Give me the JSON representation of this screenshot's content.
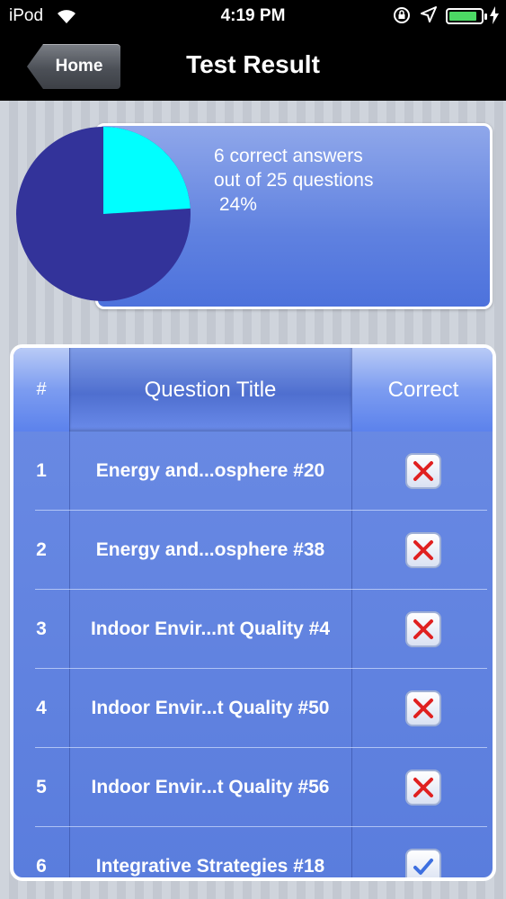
{
  "status_bar": {
    "carrier": "iPod",
    "time": "4:19 PM",
    "battery_color": "#4cd964"
  },
  "nav": {
    "back_label": "Home",
    "title": "Test Result"
  },
  "summary": {
    "line1": "6 correct answers",
    "line2": "out of 25 questions",
    "line3": " 24%",
    "correct": 6,
    "total": 25,
    "pie_colors": {
      "correct": "#00ffff",
      "incorrect": "#33339a"
    }
  },
  "table": {
    "headers": {
      "number": "#",
      "title": "Question Title",
      "correct": "Correct"
    },
    "rows": [
      {
        "number": "1",
        "title": "Energy and...osphere #20",
        "correct": false
      },
      {
        "number": "2",
        "title": "Energy and...osphere #38",
        "correct": false
      },
      {
        "number": "3",
        "title": "Indoor Envir...nt Quality #4",
        "correct": false
      },
      {
        "number": "4",
        "title": "Indoor Envir...t Quality #50",
        "correct": false
      },
      {
        "number": "5",
        "title": "Indoor Envir...t Quality #56",
        "correct": false
      },
      {
        "number": "6",
        "title": "Integrative Strategies #18",
        "correct": true
      }
    ]
  }
}
